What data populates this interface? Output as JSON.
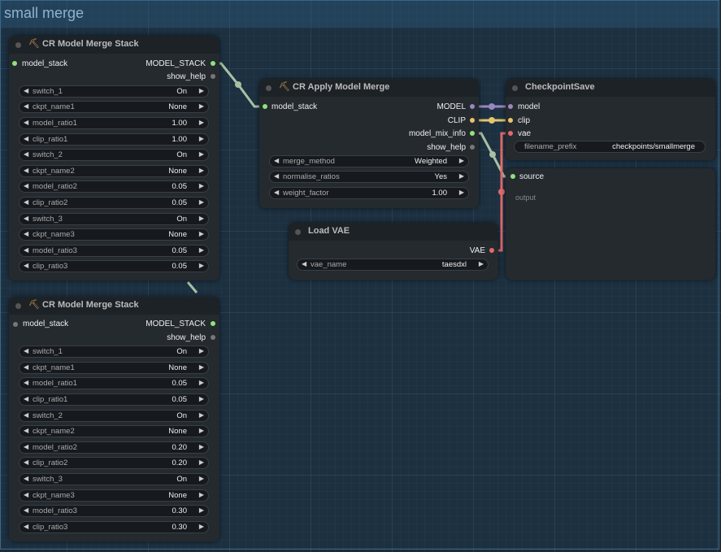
{
  "group": {
    "title": "small merge"
  },
  "colors": {
    "model": "#9a86c0",
    "clip": "#e6c36e",
    "vae": "#e26a6a",
    "generic": "#8ee37f",
    "inactive": "#777"
  },
  "stack1": {
    "title": "CR Model Merge Stack",
    "title_icon": "pickaxe-icon",
    "input": "model_stack",
    "outputs": [
      "MODEL_STACK",
      "show_help"
    ],
    "widgets": [
      {
        "name": "switch_1",
        "value": "On"
      },
      {
        "name": "ckpt_name1",
        "value": "None"
      },
      {
        "name": "model_ratio1",
        "value": "1.00"
      },
      {
        "name": "clip_ratio1",
        "value": "1.00"
      },
      {
        "name": "switch_2",
        "value": "On"
      },
      {
        "name": "ckpt_name2",
        "value": "None"
      },
      {
        "name": "model_ratio2",
        "value": "0.05"
      },
      {
        "name": "clip_ratio2",
        "value": "0.05"
      },
      {
        "name": "switch_3",
        "value": "On"
      },
      {
        "name": "ckpt_name3",
        "value": "None"
      },
      {
        "name": "model_ratio3",
        "value": "0.05"
      },
      {
        "name": "clip_ratio3",
        "value": "0.05"
      }
    ]
  },
  "stack2": {
    "title": "CR Model Merge Stack",
    "title_icon": "pickaxe-icon",
    "input": "model_stack",
    "outputs": [
      "MODEL_STACK",
      "show_help"
    ],
    "widgets": [
      {
        "name": "switch_1",
        "value": "On"
      },
      {
        "name": "ckpt_name1",
        "value": "None"
      },
      {
        "name": "model_ratio1",
        "value": "0.05"
      },
      {
        "name": "clip_ratio1",
        "value": "0.05"
      },
      {
        "name": "switch_2",
        "value": "On"
      },
      {
        "name": "ckpt_name2",
        "value": "None"
      },
      {
        "name": "model_ratio2",
        "value": "0.20"
      },
      {
        "name": "clip_ratio2",
        "value": "0.20"
      },
      {
        "name": "switch_3",
        "value": "On"
      },
      {
        "name": "ckpt_name3",
        "value": "None"
      },
      {
        "name": "model_ratio3",
        "value": "0.30"
      },
      {
        "name": "clip_ratio3",
        "value": "0.30"
      }
    ]
  },
  "apply": {
    "title": "CR Apply Model Merge",
    "title_icon": "pickaxe-icon",
    "input": "model_stack",
    "outputs": [
      "MODEL",
      "CLIP",
      "model_mix_info",
      "show_help"
    ],
    "widgets": [
      {
        "name": "merge_method",
        "value": "Weighted"
      },
      {
        "name": "normalise_ratios",
        "value": "Yes"
      },
      {
        "name": "weight_factor",
        "value": "1.00"
      }
    ]
  },
  "vae": {
    "title": "Load VAE",
    "output": "VAE",
    "widget": {
      "name": "vae_name",
      "value": "taesdxl"
    }
  },
  "save": {
    "title": "CheckpointSave",
    "inputs": [
      "model",
      "clip",
      "vae"
    ],
    "widget": {
      "name": "filename_prefix",
      "value": "checkpoints/smallmerge"
    }
  },
  "show": {
    "input": "source",
    "output_label": "output"
  }
}
